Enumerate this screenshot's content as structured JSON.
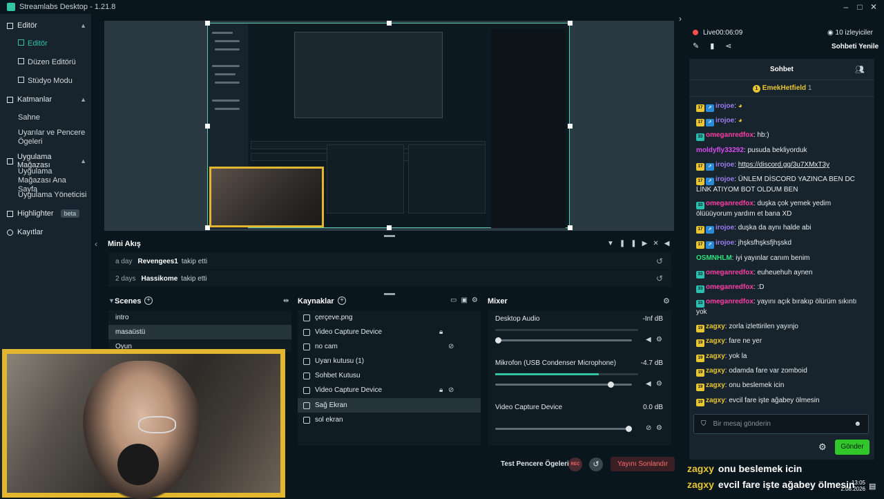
{
  "app": {
    "title": "Streamlabs Desktop - 1.21.8"
  },
  "window_controls": {
    "minimize": "–",
    "maximize": "□",
    "close": "✕"
  },
  "sidebar": {
    "sections": [
      {
        "label": "Editör",
        "items": [
          {
            "label": "Editör",
            "active": true
          },
          {
            "label": "Düzen Editörü"
          },
          {
            "label": "Stüdyo Modu"
          }
        ]
      },
      {
        "label": "Katmanlar",
        "items": [
          {
            "label": "Sahne"
          },
          {
            "label": "Uyarılar ve Pencere Ögeleri"
          }
        ]
      },
      {
        "label": "Uygulama Mağazası",
        "items": [
          {
            "label": "Uygulama Mağazası Ana Sayfa"
          },
          {
            "label": "Uygulama Yöneticisi"
          }
        ]
      }
    ],
    "highlighter": {
      "label": "Highlighter",
      "badge": "beta"
    },
    "recordings": {
      "label": "Kayıtlar"
    }
  },
  "mini_akis": {
    "title": "Mini Akış",
    "rows": [
      {
        "time": "a day",
        "user": "Revengees1",
        "action": "takip etti"
      },
      {
        "time": "2 days",
        "user": "Hassikome",
        "action": "takip etti"
      }
    ]
  },
  "scenes": {
    "title": "Scenes",
    "items": [
      {
        "label": "intro"
      },
      {
        "label": "masaüstü",
        "selected": true
      },
      {
        "label": "Oyun"
      }
    ]
  },
  "sources": {
    "title": "Kaynaklar",
    "items": [
      {
        "label": "çerçeve.png"
      },
      {
        "label": "Video Capture Device"
      },
      {
        "label": "no cam"
      },
      {
        "label": "Uyarı kutusu (1)"
      },
      {
        "label": "Sohbet Kutusu"
      },
      {
        "label": "Video Capture Device"
      },
      {
        "label": "Sağ Ekran",
        "selected": true
      },
      {
        "label": "sol ekran"
      }
    ]
  },
  "mixer": {
    "title": "Mixer",
    "channels": [
      {
        "name": "Desktop Audio",
        "db": "-Inf dB",
        "volume": 0.0
      },
      {
        "name": "Mikrofon (USB Condenser Microphone)",
        "db": "-4.7 dB",
        "volume": 0.86
      },
      {
        "name": "Video Capture Device",
        "db": "0.0 dB",
        "volume": 1.0
      }
    ]
  },
  "footer": {
    "test_label": "Test Pencere Ögeleri",
    "rec_label": "REC",
    "end_stream": "Yayını Sonlandır"
  },
  "stream_status": {
    "live": "Live",
    "uptime": "00:06:09",
    "viewers": "10 izleyiciler",
    "refresh_chat": "Sohbeti Yenile"
  },
  "chat": {
    "title": "Sohbet",
    "top_supporter": {
      "rank": "1",
      "name": "EmekHetfield",
      "count": "1"
    },
    "messages": [
      {
        "badge": "17",
        "badge_color": "yellow",
        "sub": true,
        "user": "irojoe",
        "ucls": "u-irojoe",
        "text": ""
      },
      {
        "badge": "17",
        "badge_color": "yellow",
        "sub": true,
        "user": "irojoe",
        "ucls": "u-irojoe",
        "text": ""
      },
      {
        "badge": "33",
        "badge_color": "teal",
        "user": "omeganredfox",
        "ucls": "u-omegan",
        "text": "hb:)"
      },
      {
        "user": "moldyfly33292",
        "ucls": "u-moldy",
        "text": "pusuda bekliyorduk"
      },
      {
        "badge": "17",
        "badge_color": "yellow",
        "sub": true,
        "user": "irojoe",
        "ucls": "u-irojoe",
        "text": "https://discord.gg/3u7XMxT3y",
        "link": true
      },
      {
        "badge": "17",
        "badge_color": "yellow",
        "sub": true,
        "user": "irojoe",
        "ucls": "u-irojoe",
        "text": "ÜNLEM DİSCORD YAZINCA BEN DC LİNK ATIYOM BOT OLDUM BEN"
      },
      {
        "badge": "33",
        "badge_color": "teal",
        "user": "omeganredfox",
        "ucls": "u-omegan",
        "text": "duşka çok yemek yedim ölüüüyorum yardım et bana XD"
      },
      {
        "badge": "17",
        "badge_color": "yellow",
        "sub": true,
        "user": "irojoe",
        "ucls": "u-irojoe",
        "text": "duşka da aynı halde abi"
      },
      {
        "badge": "17",
        "badge_color": "yellow",
        "sub": true,
        "user": "irojoe",
        "ucls": "u-irojoe",
        "text": "jhşksfhşksfjhşskd"
      },
      {
        "user": "OSMNHLM",
        "ucls": "u-osm",
        "text": "iyi yayınlar canım benim"
      },
      {
        "badge": "33",
        "badge_color": "teal",
        "user": "omeganredfox",
        "ucls": "u-omegan",
        "text": "euheuehuh aynen"
      },
      {
        "badge": "33",
        "badge_color": "teal",
        "user": "omeganredfox",
        "ucls": "u-omegan",
        "text": ":D"
      },
      {
        "badge": "33",
        "badge_color": "teal",
        "user": "omeganredfox",
        "ucls": "u-omegan",
        "text": "yayını açık bırakıp ölürüm sıkıntı yok"
      },
      {
        "badge": "19",
        "badge_color": "yellow",
        "user": "zagxy",
        "ucls": "u-zagxy",
        "text": "zorla izlettirilen yayınjo"
      },
      {
        "badge": "19",
        "badge_color": "yellow",
        "user": "zagxy",
        "ucls": "u-zagxy",
        "text": "fare ne yer"
      },
      {
        "badge": "19",
        "badge_color": "yellow",
        "user": "zagxy",
        "ucls": "u-zagxy",
        "text": "yok la"
      },
      {
        "badge": "19",
        "badge_color": "yellow",
        "user": "zagxy",
        "ucls": "u-zagxy",
        "text": "odamda fare var zomboid"
      },
      {
        "badge": "19",
        "badge_color": "yellow",
        "user": "zagxy",
        "ucls": "u-zagxy",
        "text": "onu beslemek icin"
      },
      {
        "badge": "19",
        "badge_color": "yellow",
        "user": "zagxy",
        "ucls": "u-zagxy",
        "text": "evcil fare işte ağabey ölmesin"
      }
    ],
    "input_placeholder": "Bir mesaj gönderin",
    "send": "Gönder"
  },
  "overlay_chat": [
    {
      "user": "zagxy",
      "text": "onu beslemek icin"
    },
    {
      "user": "zagxy",
      "text": "evcil fare işte ağabey ölmesin"
    }
  ],
  "taskbar": {
    "time": "13:05",
    "date": "2.08.2026"
  },
  "colors": {
    "accent": "#31c3a2",
    "live": "#ff4d4d",
    "send": "#31c72b",
    "frame": "#e2b62f"
  }
}
